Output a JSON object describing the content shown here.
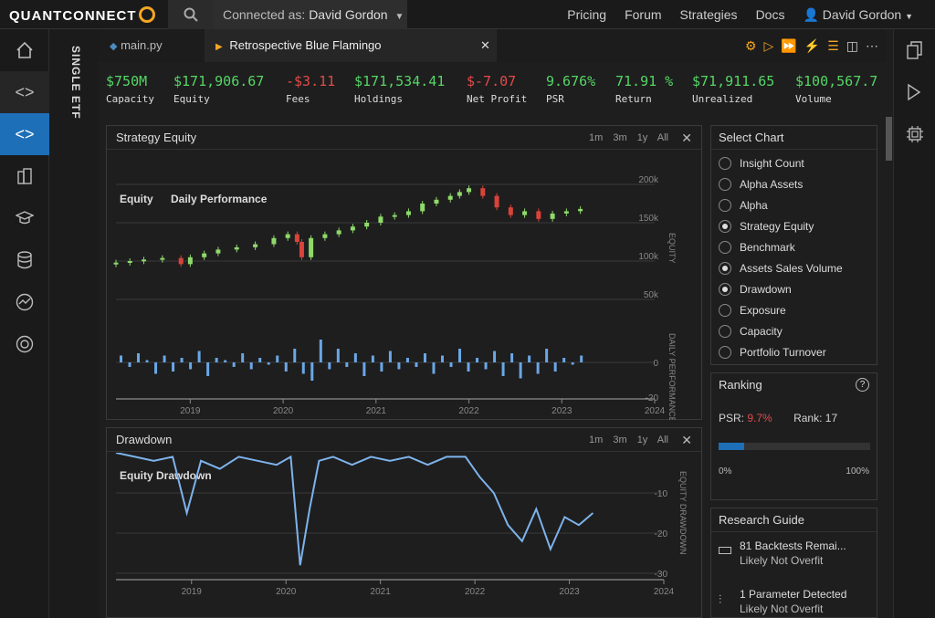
{
  "topbar": {
    "logo_a": "QUANT",
    "logo_b": "CONNECT",
    "connected_label": "Connected as:",
    "connected_user": "David Gordon",
    "nav": [
      "Pricing",
      "Forum",
      "Strategies",
      "Docs"
    ],
    "user_name": "David Gordon"
  },
  "vertical_tab": "SINGLE ETF",
  "tabs": [
    {
      "label": "main.py"
    },
    {
      "label": "Retrospective Blue Flamingo"
    }
  ],
  "stats": [
    {
      "value": "$750M",
      "label": "Capacity",
      "color": "green"
    },
    {
      "value": "$171,906.67",
      "label": "Equity",
      "color": "green"
    },
    {
      "value": "-$3.11",
      "label": "Fees",
      "color": "red"
    },
    {
      "value": "$171,534.41",
      "label": "Holdings",
      "color": "green"
    },
    {
      "value": "$-7.07",
      "label": "Net Profit",
      "color": "red"
    },
    {
      "value": "9.676%",
      "label": "PSR",
      "color": "green"
    },
    {
      "value": "71.91 %",
      "label": "Return",
      "color": "green"
    },
    {
      "value": "$71,911.65",
      "label": "Unrealized",
      "color": "green"
    },
    {
      "value": "$100,567.7",
      "label": "Volume",
      "color": "green"
    }
  ],
  "strategy_panel": {
    "title": "Strategy Equity",
    "ranges": [
      "1m",
      "3m",
      "1y",
      "All"
    ],
    "legend_equity": "Equity",
    "legend_daily": "Daily Performance",
    "equity_axis_label": "EQUITY",
    "daily_axis_label": "DAILY PERFORMANCE",
    "equity_ticks": [
      "200k",
      "150k",
      "100k",
      "50k"
    ],
    "daily_ticks": [
      "0",
      "-20"
    ],
    "x_ticks": [
      "2019",
      "2020",
      "2021",
      "2022",
      "2023",
      "2024"
    ]
  },
  "drawdown_panel": {
    "title": "Drawdown",
    "ranges": [
      "1m",
      "3m",
      "1y",
      "All"
    ],
    "legend": "Equity Drawdown",
    "axis_label": "EQUITY DRAWDOWN",
    "y_ticks": [
      "-10",
      "-20",
      "-30"
    ],
    "x_ticks": [
      "2019",
      "2020",
      "2021",
      "2022",
      "2023",
      "2024"
    ]
  },
  "select_chart": {
    "title": "Select Chart",
    "items": [
      {
        "label": "Insight Count",
        "on": false
      },
      {
        "label": "Alpha Assets",
        "on": false
      },
      {
        "label": "Alpha",
        "on": false
      },
      {
        "label": "Strategy Equity",
        "on": true
      },
      {
        "label": "Benchmark",
        "on": false
      },
      {
        "label": "Assets Sales Volume",
        "on": true
      },
      {
        "label": "Drawdown",
        "on": true
      },
      {
        "label": "Exposure",
        "on": false
      },
      {
        "label": "Capacity",
        "on": false
      },
      {
        "label": "Portfolio Turnover",
        "on": false
      }
    ]
  },
  "ranking": {
    "title": "Ranking",
    "psr_label": "PSR:",
    "psr_value": "9.7%",
    "rank_label": "Rank:",
    "rank_value": "17",
    "bar_fill": 0.17,
    "min_label": "0%",
    "max_label": "100%"
  },
  "research_guide": {
    "title": "Research Guide",
    "items": [
      {
        "title": "81 Backtests Remai...",
        "sub": "Likely Not Overfit"
      },
      {
        "title": "1 Parameter Detected",
        "sub": "Likely Not Overfit"
      }
    ]
  },
  "chart_data": [
    {
      "type": "candlestick",
      "name": "Equity",
      "x": [
        2018.2,
        2018.35,
        2018.5,
        2018.7,
        2018.9,
        2019.0,
        2019.15,
        2019.3,
        2019.5,
        2019.7,
        2019.9,
        2020.05,
        2020.15,
        2020.2,
        2020.3,
        2020.45,
        2020.6,
        2020.75,
        2020.9,
        2021.05,
        2021.2,
        2021.35,
        2021.5,
        2021.65,
        2021.8,
        2021.9,
        2022.0,
        2022.15,
        2022.3,
        2022.45,
        2022.6,
        2022.75,
        2022.9,
        2023.05,
        2023.2
      ],
      "close": [
        98,
        100,
        102,
        104,
        96,
        105,
        110,
        115,
        118,
        122,
        130,
        135,
        125,
        105,
        130,
        135,
        140,
        145,
        150,
        158,
        160,
        165,
        175,
        180,
        185,
        190,
        195,
        185,
        170,
        160,
        165,
        155,
        162,
        165,
        168
      ],
      "ylim": [
        50000,
        200000
      ],
      "yunit": "k"
    },
    {
      "type": "bar",
      "name": "Daily Performance",
      "values": [
        3,
        -2,
        4,
        1,
        -5,
        3,
        -4,
        2,
        -3,
        5,
        -6,
        2,
        1,
        -2,
        4,
        -3,
        2,
        -1,
        3,
        -4,
        6,
        -5,
        -8,
        10,
        -3,
        6,
        -2,
        4,
        -6,
        3,
        -4,
        5,
        -3,
        2,
        -2,
        4,
        -5,
        3,
        -2,
        6,
        -4,
        2,
        -3,
        5,
        -6,
        4,
        -7,
        3,
        -5,
        6,
        -4,
        2,
        -1,
        3
      ],
      "ylim": [
        -20,
        5
      ]
    },
    {
      "type": "line",
      "name": "Equity Drawdown",
      "x": [
        2018.2,
        2018.4,
        2018.6,
        2018.8,
        2018.95,
        2019.1,
        2019.3,
        2019.5,
        2019.7,
        2019.9,
        2020.05,
        2020.15,
        2020.25,
        2020.35,
        2020.5,
        2020.7,
        2020.9,
        2021.1,
        2021.3,
        2021.5,
        2021.7,
        2021.9,
        2022.05,
        2022.2,
        2022.35,
        2022.5,
        2022.65,
        2022.8,
        2022.95,
        2023.1,
        2023.25
      ],
      "values": [
        0,
        -1,
        -2,
        -1,
        -15,
        -2,
        -4,
        -1,
        -2,
        -3,
        -1,
        -28,
        -14,
        -2,
        -1,
        -3,
        -1,
        -2,
        -1,
        -3,
        -1,
        -1,
        -6,
        -10,
        -18,
        -22,
        -14,
        -24,
        -16,
        -18,
        -15
      ],
      "ylim": [
        -30,
        0
      ]
    }
  ]
}
